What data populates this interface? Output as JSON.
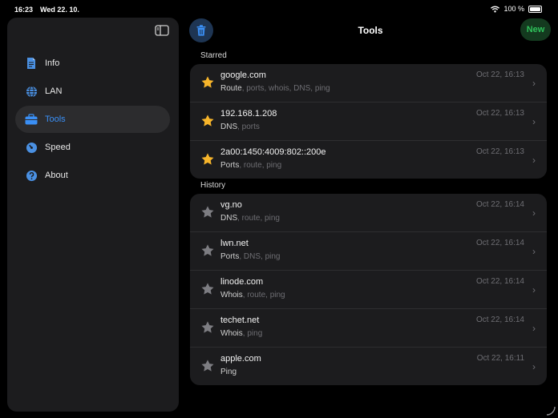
{
  "status": {
    "time": "16:23",
    "date": "Wed 22. 10.",
    "battery": "100 %"
  },
  "sidebar": {
    "items": [
      {
        "label": "Info",
        "icon": "document-icon",
        "active": false
      },
      {
        "label": "LAN",
        "icon": "globe-icon",
        "active": false
      },
      {
        "label": "Tools",
        "icon": "toolbox-icon",
        "active": true
      },
      {
        "label": "Speed",
        "icon": "gauge-icon",
        "active": false
      },
      {
        "label": "About",
        "icon": "question-icon",
        "active": false
      }
    ]
  },
  "header": {
    "title": "Tools",
    "new_label": "New"
  },
  "starred": {
    "title": "Starred",
    "rows": [
      {
        "host": "google.com",
        "date": "Oct 22, 16:13",
        "primary": "Route",
        "rest": ", ports, whois, DNS, ping"
      },
      {
        "host": "192.168.1.208",
        "date": "Oct 22, 16:13",
        "primary": "DNS",
        "rest": ", ports"
      },
      {
        "host": "2a00:1450:4009:802::200e",
        "date": "Oct 22, 16:13",
        "primary": "Ports",
        "rest": ", route, ping"
      }
    ]
  },
  "history": {
    "title": "History",
    "rows": [
      {
        "host": "vg.no",
        "date": "Oct 22, 16:14",
        "primary": "DNS",
        "rest": ", route, ping"
      },
      {
        "host": "lwn.net",
        "date": "Oct 22, 16:14",
        "primary": "Ports",
        "rest": ", DNS, ping"
      },
      {
        "host": "linode.com",
        "date": "Oct 22, 16:14",
        "primary": "Whois",
        "rest": ", route, ping"
      },
      {
        "host": "techet.net",
        "date": "Oct 22, 16:14",
        "primary": "Whois",
        "rest": ", ping"
      },
      {
        "host": "apple.com",
        "date": "Oct 22, 16:11",
        "primary": "Ping",
        "rest": ""
      }
    ]
  },
  "colors": {
    "accent": "#3a8ff5",
    "star_filled": "#f7b52b",
    "star_empty": "#7d7d82",
    "new_green": "#2fc25b"
  }
}
